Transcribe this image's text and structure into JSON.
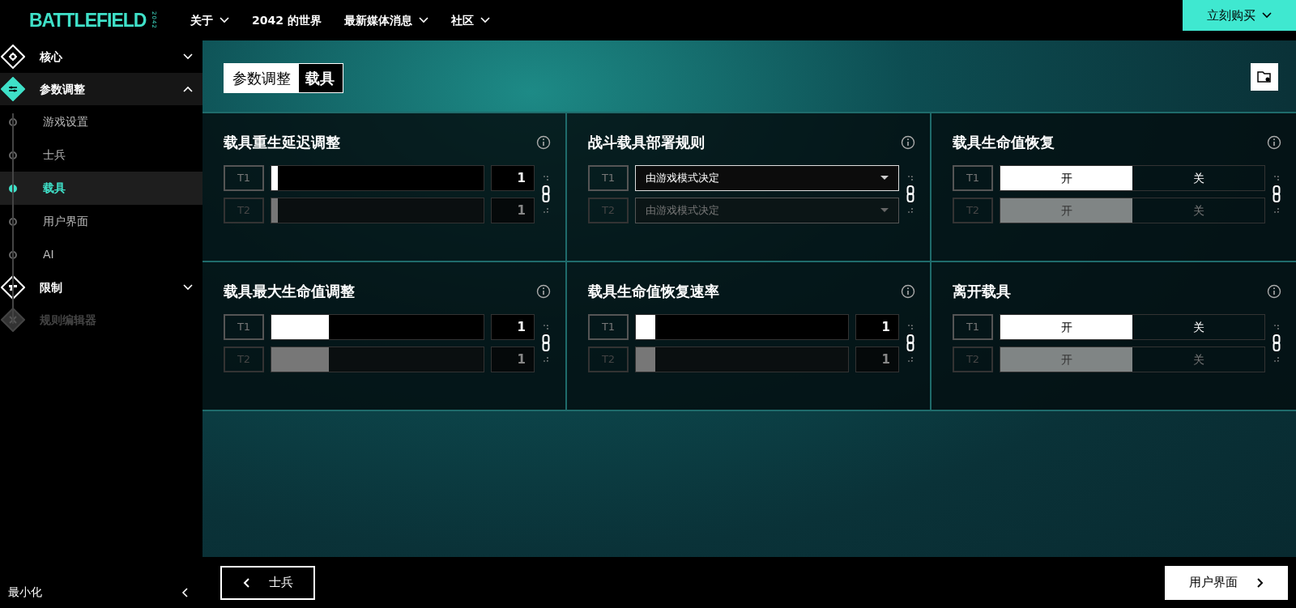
{
  "brand": {
    "logo": "BATTLEFIELD",
    "sub": "2042"
  },
  "nav": [
    {
      "label": "关于",
      "dropdown": true
    },
    {
      "label": "2042 的世界",
      "dropdown": false
    },
    {
      "label": "最新媒体消息",
      "dropdown": true
    },
    {
      "label": "社区",
      "dropdown": true
    }
  ],
  "buy_button": "立刻购买",
  "sidebar": {
    "items": [
      {
        "label": "核心",
        "expanded": false,
        "disabled": false,
        "selected": false
      },
      {
        "label": "参数调整",
        "expanded": true,
        "disabled": false,
        "selected": true,
        "children": [
          {
            "label": "游戏设置",
            "selected": false
          },
          {
            "label": "士兵",
            "selected": false
          },
          {
            "label": "载具",
            "selected": true
          },
          {
            "label": "用户界面",
            "selected": false
          },
          {
            "label": "AI",
            "selected": false
          }
        ]
      },
      {
        "label": "限制",
        "expanded": false,
        "disabled": false,
        "selected": false
      },
      {
        "label": "规则编辑器",
        "expanded": false,
        "disabled": true,
        "selected": false
      }
    ],
    "minimize": "最小化"
  },
  "breadcrumb": [
    "参数调整",
    "载具"
  ],
  "settings": [
    {
      "title": "载具重生延迟调整",
      "kind": "slider",
      "rows": [
        {
          "team": "T1",
          "level": 0.03,
          "value": "1",
          "disabled": false
        },
        {
          "team": "T2",
          "level": 0.03,
          "value": "1",
          "disabled": true
        }
      ]
    },
    {
      "title": "战斗载具部署规则",
      "kind": "dropdown",
      "rows": [
        {
          "team": "T1",
          "value": "由游戏模式决定",
          "disabled": false
        },
        {
          "team": "T2",
          "value": "由游戏模式决定",
          "disabled": true
        }
      ]
    },
    {
      "title": "载具生命值恢复",
      "kind": "toggle",
      "rows": [
        {
          "team": "T1",
          "options": [
            {
              "label": "开",
              "selected": true
            },
            {
              "label": "关",
              "selected": false
            }
          ],
          "disabled": false
        },
        {
          "team": "T2",
          "options": [
            {
              "label": "开",
              "selected": true
            },
            {
              "label": "关",
              "selected": false
            }
          ],
          "disabled": true
        }
      ]
    },
    {
      "title": "载具最大生命值调整",
      "kind": "slider",
      "rows": [
        {
          "team": "T1",
          "level": 0.27,
          "value": "1",
          "disabled": false
        },
        {
          "team": "T2",
          "level": 0.27,
          "value": "1",
          "disabled": true
        }
      ]
    },
    {
      "title": "载具生命值恢复速率",
      "kind": "slider",
      "rows": [
        {
          "team": "T1",
          "level": 0.09,
          "value": "1",
          "disabled": false
        },
        {
          "team": "T2",
          "level": 0.09,
          "value": "1",
          "disabled": true
        }
      ]
    },
    {
      "title": "离开载具",
      "kind": "toggle",
      "rows": [
        {
          "team": "T1",
          "options": [
            {
              "label": "开",
              "selected": true
            },
            {
              "label": "关",
              "selected": false
            }
          ],
          "disabled": false
        },
        {
          "team": "T2",
          "options": [
            {
              "label": "开",
              "selected": true
            },
            {
              "label": "关",
              "selected": false
            }
          ],
          "disabled": true
        }
      ]
    }
  ],
  "footer": {
    "back": "士兵",
    "next": "用户界面"
  }
}
